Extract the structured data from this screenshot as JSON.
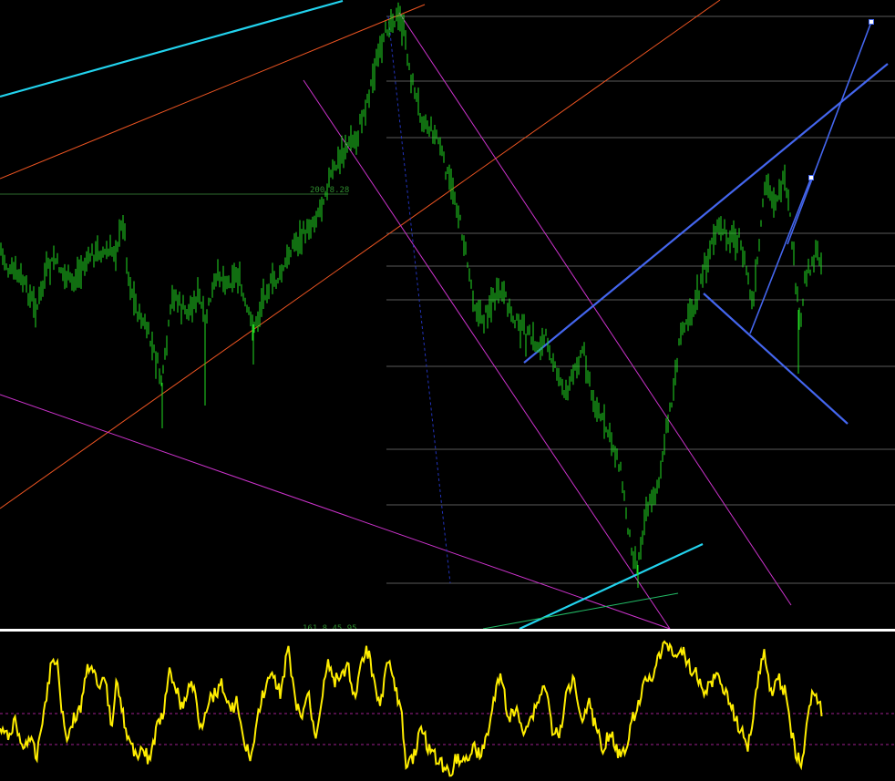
{
  "chart_data": [
    {
      "type": "bar",
      "title": "",
      "description": "OHLC price bars (green) with hand-drawn trendlines, channels and horizontal levels",
      "candle_color": "#22dd22",
      "annotations": [
        "200.8.28",
        "161.8.45.95"
      ],
      "close_path": [
        [
          0,
          270
        ],
        [
          10,
          300
        ],
        [
          20,
          300
        ],
        [
          30,
          320
        ],
        [
          40,
          340
        ],
        [
          50,
          300
        ],
        [
          60,
          285
        ],
        [
          70,
          300
        ],
        [
          80,
          310
        ],
        [
          90,
          295
        ],
        [
          100,
          280
        ],
        [
          110,
          275
        ],
        [
          120,
          280
        ],
        [
          128,
          270
        ],
        [
          136,
          240
        ],
        [
          140,
          300
        ],
        [
          150,
          340
        ],
        [
          160,
          360
        ],
        [
          170,
          390
        ],
        [
          178,
          420
        ],
        [
          185,
          360
        ],
        [
          190,
          320
        ],
        [
          200,
          340
        ],
        [
          210,
          340
        ],
        [
          218,
          320
        ],
        [
          225,
          360
        ],
        [
          230,
          330
        ],
        [
          240,
          300
        ],
        [
          250,
          310
        ],
        [
          260,
          300
        ],
        [
          270,
          340
        ],
        [
          280,
          360
        ],
        [
          290,
          320
        ],
        [
          300,
          310
        ],
        [
          310,
          300
        ],
        [
          320,
          270
        ],
        [
          330,
          260
        ],
        [
          340,
          250
        ],
        [
          350,
          230
        ],
        [
          360,
          200
        ],
        [
          370,
          180
        ],
        [
          380,
          160
        ],
        [
          390,
          155
        ],
        [
          400,
          120
        ],
        [
          410,
          80
        ],
        [
          420,
          50
        ],
        [
          428,
          20
        ],
        [
          435,
          20
        ],
        [
          442,
          30
        ],
        [
          450,
          80
        ],
        [
          460,
          120
        ],
        [
          470,
          140
        ],
        [
          480,
          150
        ],
        [
          490,
          190
        ],
        [
          500,
          220
        ],
        [
          508,
          260
        ],
        [
          515,
          300
        ],
        [
          522,
          340
        ],
        [
          530,
          350
        ],
        [
          540,
          330
        ],
        [
          550,
          320
        ],
        [
          560,
          340
        ],
        [
          570,
          360
        ],
        [
          580,
          370
        ],
        [
          590,
          380
        ],
        [
          600,
          370
        ],
        [
          610,
          410
        ],
        [
          620,
          430
        ],
        [
          630,
          410
        ],
        [
          640,
          380
        ],
        [
          650,
          440
        ],
        [
          660,
          460
        ],
        [
          670,
          480
        ],
        [
          680,
          510
        ],
        [
          688,
          570
        ],
        [
          695,
          610
        ],
        [
          700,
          620
        ],
        [
          708,
          560
        ],
        [
          716,
          550
        ],
        [
          724,
          520
        ],
        [
          732,
          470
        ],
        [
          740,
          420
        ],
        [
          748,
          360
        ],
        [
          756,
          340
        ],
        [
          764,
          330
        ],
        [
          772,
          300
        ],
        [
          780,
          270
        ],
        [
          790,
          250
        ],
        [
          800,
          260
        ],
        [
          810,
          260
        ],
        [
          820,
          300
        ],
        [
          826,
          340
        ],
        [
          832,
          280
        ],
        [
          840,
          200
        ],
        [
          850,
          220
        ],
        [
          860,
          200
        ],
        [
          866,
          230
        ],
        [
          872,
          300
        ],
        [
          878,
          360
        ],
        [
          884,
          300
        ],
        [
          890,
          290
        ],
        [
          896,
          280
        ],
        [
          902,
          285
        ]
      ],
      "horizontal_levels": [
        18,
        89,
        151,
        256,
        292,
        329,
        402,
        493,
        554,
        640
      ],
      "trendlines": [
        {
          "x1": 0,
          "y1": 106,
          "x2": 376,
          "y2": 1,
          "color": "#22d3ee",
          "width": 2.2
        },
        {
          "x1": 0,
          "y1": 196,
          "x2": 466,
          "y2": 5,
          "color": "#ee5522",
          "width": 1
        },
        {
          "x1": 0,
          "y1": 558,
          "x2": 790,
          "y2": 0,
          "color": "#ee5522",
          "width": 1
        },
        {
          "x1": 0,
          "y1": 433,
          "x2": 735,
          "y2": 690,
          "color": "#cc33cc",
          "width": 1
        },
        {
          "x1": 333,
          "y1": 88,
          "x2": 735,
          "y2": 690,
          "color": "#cc33cc",
          "width": 1
        },
        {
          "x1": 438,
          "y1": 14,
          "x2": 868,
          "y2": 664,
          "color": "#cc33cc",
          "width": 1
        },
        {
          "x1": 426,
          "y1": 18,
          "x2": 494,
          "y2": 640,
          "color": "#2233bb",
          "width": 1,
          "dash": "3,3"
        },
        {
          "x1": 575,
          "y1": 398,
          "x2": 974,
          "y2": 70,
          "color": "#4466ee",
          "width": 2.2
        },
        {
          "x1": 772,
          "y1": 322,
          "x2": 930,
          "y2": 465,
          "color": "#4466ee",
          "width": 2.2
        },
        {
          "x1": 823,
          "y1": 366,
          "x2": 890,
          "y2": 195,
          "color": "#4466ee",
          "width": 1.6
        },
        {
          "x1": 864,
          "y1": 268,
          "x2": 956,
          "y2": 24,
          "color": "#4466ee",
          "width": 1.6
        },
        {
          "x1": 570,
          "y1": 690,
          "x2": 771,
          "y2": 597,
          "color": "#22d3ee",
          "width": 2.2
        },
        {
          "x1": 530,
          "y1": 690,
          "x2": 744,
          "y2": 651,
          "color": "#22bb66",
          "width": 1
        }
      ],
      "ylim": [
        0,
        690
      ]
    },
    {
      "type": "line",
      "title": "",
      "description": "Oscillator sub-window (yellow line) with two dotted reference levels",
      "line_color": "#ffee00",
      "reference_levels": [
        783,
        817
      ],
      "osc_path": [
        [
          0,
          800
        ],
        [
          8,
          810
        ],
        [
          16,
          790
        ],
        [
          24,
          820
        ],
        [
          32,
          810
        ],
        [
          40,
          830
        ],
        [
          48,
          780
        ],
        [
          56,
          730
        ],
        [
          62,
          720
        ],
        [
          68,
          780
        ],
        [
          74,
          810
        ],
        [
          80,
          790
        ],
        [
          88,
          780
        ],
        [
          94,
          740
        ],
        [
          100,
          725
        ],
        [
          108,
          760
        ],
        [
          116,
          745
        ],
        [
          122,
          800
        ],
        [
          128,
          740
        ],
        [
          134,
          780
        ],
        [
          140,
          810
        ],
        [
          148,
          830
        ],
        [
          156,
          820
        ],
        [
          164,
          835
        ],
        [
          172,
          800
        ],
        [
          180,
          780
        ],
        [
          186,
          740
        ],
        [
          192,
          750
        ],
        [
          200,
          780
        ],
        [
          208,
          750
        ],
        [
          214,
          760
        ],
        [
          220,
          800
        ],
        [
          228,
          770
        ],
        [
          236,
          760
        ],
        [
          244,
          750
        ],
        [
          252,
          780
        ],
        [
          260,
          770
        ],
        [
          268,
          820
        ],
        [
          276,
          830
        ],
        [
          284,
          780
        ],
        [
          292,
          750
        ],
        [
          300,
          745
        ],
        [
          308,
          760
        ],
        [
          316,
          710
        ],
        [
          322,
          760
        ],
        [
          330,
          790
        ],
        [
          338,
          760
        ],
        [
          346,
          810
        ],
        [
          354,
          760
        ],
        [
          360,
          720
        ],
        [
          366,
          750
        ],
        [
          374,
          740
        ],
        [
          382,
          730
        ],
        [
          390,
          770
        ],
        [
          398,
          720
        ],
        [
          404,
          715
        ],
        [
          410,
          750
        ],
        [
          418,
          770
        ],
        [
          426,
          720
        ],
        [
          432,
          750
        ],
        [
          440,
          780
        ],
        [
          446,
          840
        ],
        [
          454,
          830
        ],
        [
          462,
          800
        ],
        [
          470,
          820
        ],
        [
          478,
          830
        ],
        [
          486,
          840
        ],
        [
          494,
          850
        ],
        [
          500,
          830
        ],
        [
          510,
          835
        ],
        [
          520,
          820
        ],
        [
          528,
          830
        ],
        [
          536,
          800
        ],
        [
          544,
          760
        ],
        [
          550,
          740
        ],
        [
          558,
          790
        ],
        [
          566,
          780
        ],
        [
          574,
          800
        ],
        [
          582,
          790
        ],
        [
          590,
          770
        ],
        [
          598,
          750
        ],
        [
          606,
          800
        ],
        [
          614,
          810
        ],
        [
          622,
          760
        ],
        [
          630,
          740
        ],
        [
          638,
          790
        ],
        [
          646,
          770
        ],
        [
          654,
          800
        ],
        [
          662,
          820
        ],
        [
          670,
          800
        ],
        [
          678,
          830
        ],
        [
          686,
          820
        ],
        [
          694,
          790
        ],
        [
          700,
          770
        ],
        [
          708,
          750
        ],
        [
          716,
          740
        ],
        [
          724,
          720
        ],
        [
          732,
          705
        ],
        [
          740,
          720
        ],
        [
          748,
          710
        ],
        [
          756,
          730
        ],
        [
          764,
          740
        ],
        [
          772,
          760
        ],
        [
          780,
          750
        ],
        [
          788,
          740
        ],
        [
          796,
          760
        ],
        [
          804,
          780
        ],
        [
          812,
          800
        ],
        [
          820,
          820
        ],
        [
          826,
          790
        ],
        [
          832,
          740
        ],
        [
          838,
          715
        ],
        [
          846,
          760
        ],
        [
          854,
          745
        ],
        [
          862,
          760
        ],
        [
          868,
          800
        ],
        [
          874,
          830
        ],
        [
          880,
          840
        ],
        [
          886,
          790
        ],
        [
          892,
          760
        ],
        [
          900,
          770
        ],
        [
          902,
          790
        ]
      ],
      "ylim": [
        692,
        853
      ]
    }
  ],
  "labels": {
    "top_annotation": "200.8.28",
    "bottom_annotation": "161.8.45.95"
  }
}
